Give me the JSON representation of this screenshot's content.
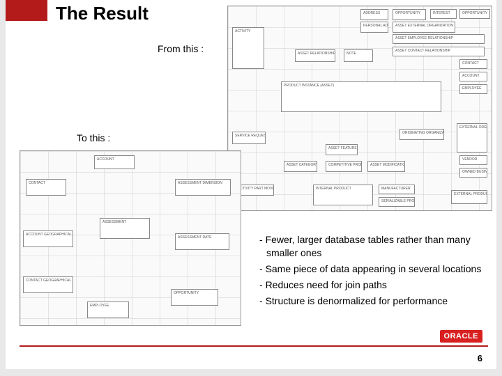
{
  "title": "The Result",
  "labels": {
    "from": "From this :",
    "to": "To this :"
  },
  "bullets": [
    "Fewer, larger database tables rather than many smaller ones",
    "Same piece of data appearing in several locations",
    "Reduces need for join paths",
    "Structure is denormalized for performance"
  ],
  "page_number": "6",
  "logo_text": "ORACLE",
  "diagram_top": {
    "nodes": [
      "ACTIVITY",
      "ADDRESS",
      "PERSONAL ADDRESS",
      "OPPORTUNITY",
      "INTEREST",
      "OPPORTUNITY",
      "ASSET EXTERNAL ORGANIZATION",
      "ASSET EMPLOYEE RELATIONSHIP",
      "ASSET RELATIONSHIP",
      "NOTE",
      "ASSET CONTACT RELATIONSHIP",
      "CONTACT",
      "ACCOUNT",
      "PRODUCT INSTANCE (ASSET)",
      "EMPLOYEE",
      "SERVICE REQUEST",
      "ASSET FEATURE",
      "ORIGINATING ORGANIZATION",
      "EXTERNAL ORGANIZATION",
      "ASSET CATEGORY",
      "COMPETITIVE PRODUCT",
      "ASSET MODIFICATION",
      "VENDOR",
      "OWNED BUSINESS UNIT",
      "ACTIVITY PART MOVEMENT",
      "INTERNAL PRODUCT",
      "MANUFACTURER",
      "SERIALIZABLE PRODUCT",
      "EXTERNAL PRODUCT"
    ]
  },
  "diagram_bottom": {
    "nodes": [
      "ACCOUNT",
      "CONTACT",
      "ASSESSMENT DIMENSION",
      "ASSESSMENT",
      "ACCOUNT GEOGRAPHICAL",
      "ASSESSMENT DATE",
      "CONTACT GEOGRAPHICAL",
      "EMPLOYEE",
      "OPPORTUNITY"
    ]
  }
}
